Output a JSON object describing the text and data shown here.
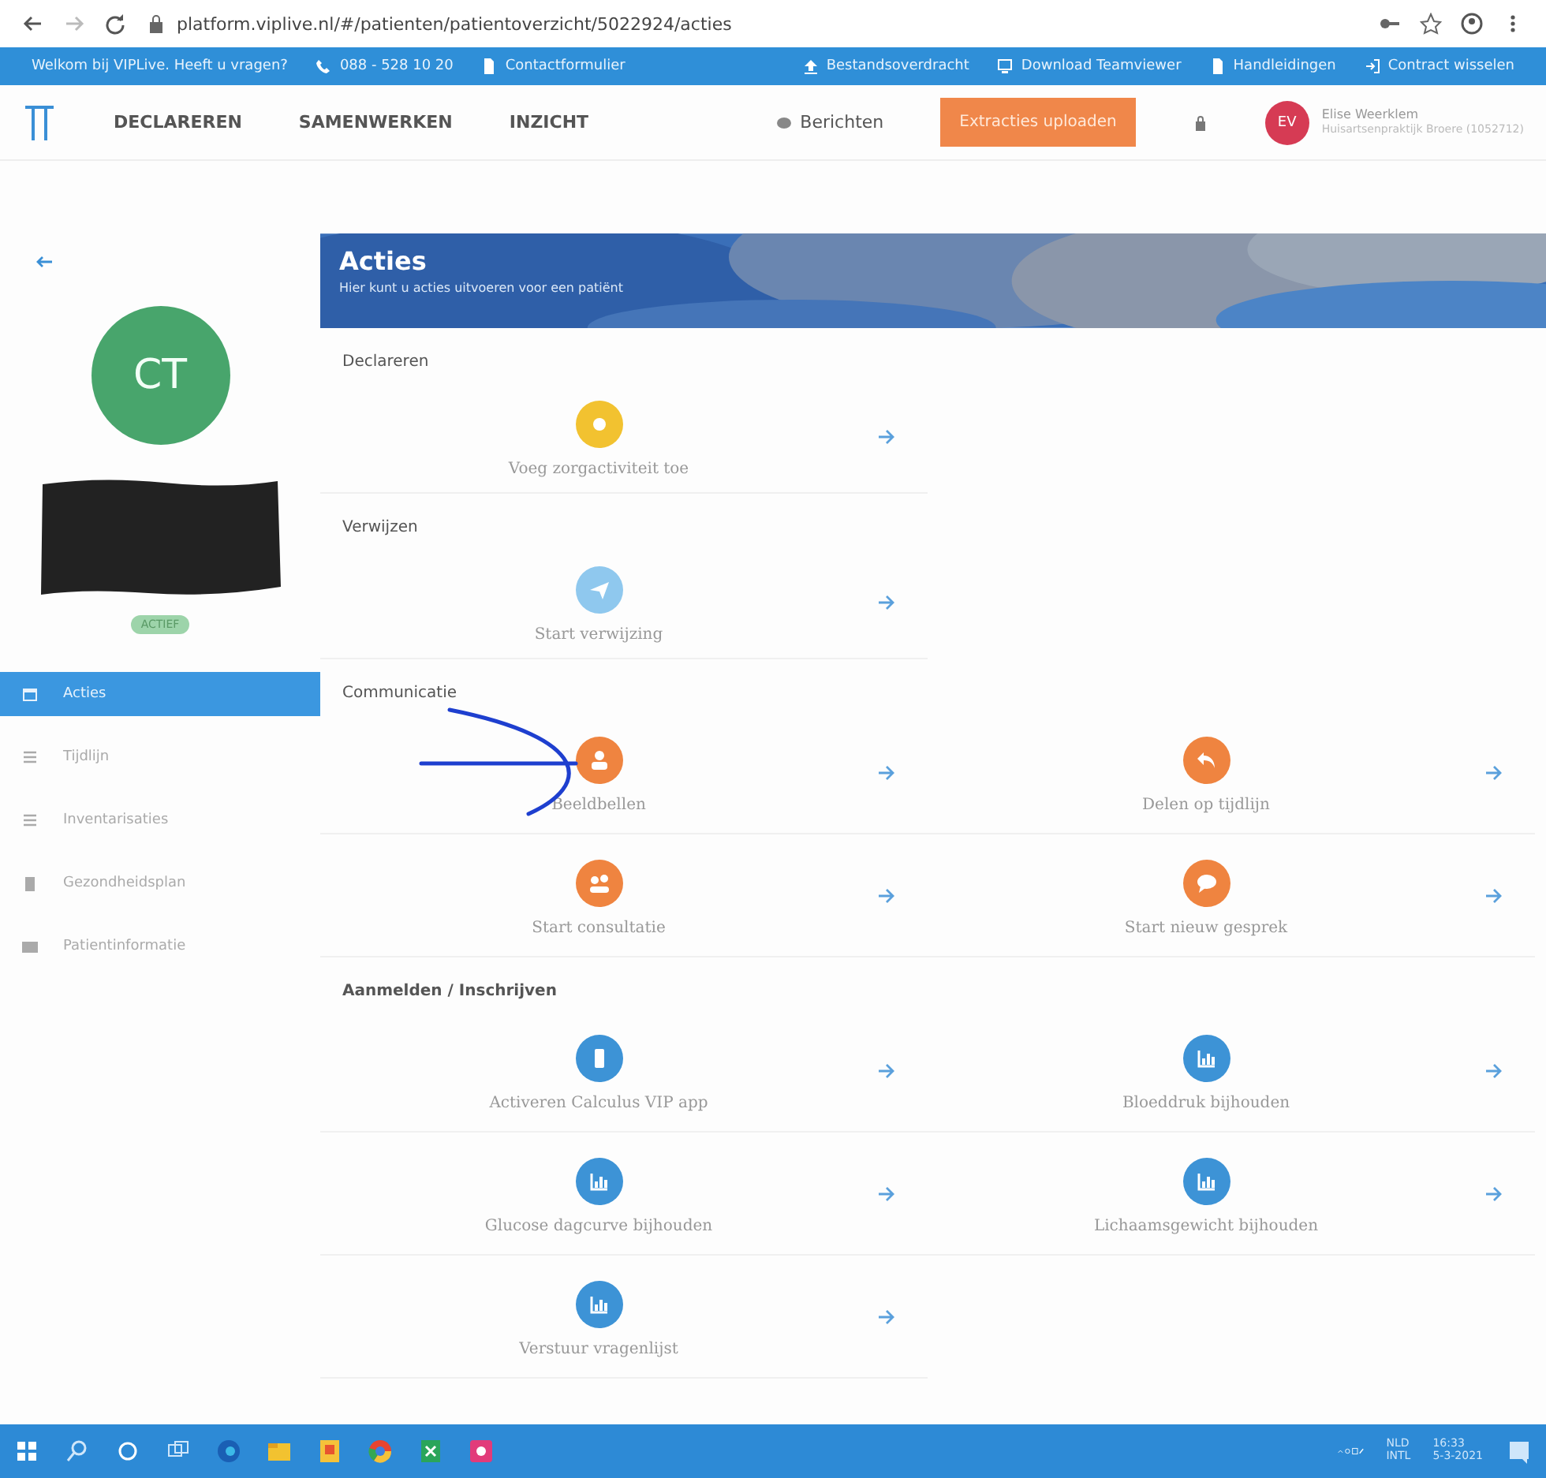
{
  "browser": {
    "url": "platform.viplive.nl/#/patienten/patientoverzicht/5022924/acties"
  },
  "topbar": {
    "welcome": "Welkom bij VIPLive. Heeft u vragen?",
    "phone": "088 - 528 10 20",
    "contact_form": "Contactformulier",
    "links": [
      {
        "label": "Bestandsoverdracht",
        "kind": "upload"
      },
      {
        "label": "Download Teamviewer",
        "kind": "monitor"
      },
      {
        "label": "Handleidingen",
        "kind": "file"
      },
      {
        "label": "Contract wisselen",
        "kind": "switch"
      }
    ]
  },
  "nav": {
    "items": [
      {
        "label": "DECLAREREN"
      },
      {
        "label": "SAMENWERKEN"
      },
      {
        "label": "INZICHT"
      }
    ],
    "messages": "Berichten",
    "upload_button": "Extracties uploaden",
    "user": {
      "initials": "EV",
      "name": "Elise Weerklem",
      "practice": "Huisartsenpraktijk Broere (1052712)"
    }
  },
  "sidebar": {
    "initials": "CT",
    "status": "ACTIEF",
    "items": [
      {
        "label": "Acties",
        "kind": "calendar",
        "selected": true
      },
      {
        "label": "Tijdlijn",
        "kind": "list",
        "selected": false
      },
      {
        "label": "Inventarisaties",
        "kind": "list",
        "selected": false
      },
      {
        "label": "Gezondheidsplan",
        "kind": "clipboard",
        "selected": false
      },
      {
        "label": "Patientinformatie",
        "kind": "card",
        "selected": false
      }
    ]
  },
  "header": {
    "title": "Acties",
    "subtitle": "Hier kunt u acties uitvoeren voor een patiënt"
  },
  "sections": [
    {
      "title": "Declareren",
      "bold": false,
      "actions": [
        {
          "label": "Voeg zorgactiviteit toe",
          "kind": "coin",
          "color": "#f2c230"
        }
      ]
    },
    {
      "title": "Verwijzen",
      "bold": false,
      "actions": [
        {
          "label": "Start verwijzing",
          "kind": "send",
          "color": "#8fc8ee"
        }
      ]
    },
    {
      "title": "Communicatie",
      "bold": false,
      "actions": [
        {
          "label": "Beeldbellen",
          "kind": "person",
          "color": "#ef8440"
        },
        {
          "label": "Delen op tijdlijn",
          "kind": "undo",
          "color": "#ef8440"
        },
        {
          "label": "Start consultatie",
          "kind": "consult",
          "color": "#ef8440"
        },
        {
          "label": "Start nieuw gesprek",
          "kind": "chat",
          "color": "#ef8440"
        }
      ]
    },
    {
      "title": "Aanmelden / Inschrijven",
      "bold": true,
      "actions": [
        {
          "label": "Activeren Calculus VIP app",
          "kind": "phone",
          "color": "#3d93d6"
        },
        {
          "label": "Bloeddruk bijhouden",
          "kind": "chart",
          "color": "#3d93d6"
        },
        {
          "label": "Glucose dagcurve bijhouden",
          "kind": "chart",
          "color": "#3d93d6"
        },
        {
          "label": "Lichaamsgewicht bijhouden",
          "kind": "chart",
          "color": "#3d93d6"
        },
        {
          "label": "Verstuur vragenlijst",
          "kind": "chart",
          "color": "#3d93d6"
        }
      ]
    }
  ],
  "taskbar": {
    "language": "NLD",
    "layout": "INTL",
    "time": "16:33",
    "date": "5-3-2021"
  }
}
